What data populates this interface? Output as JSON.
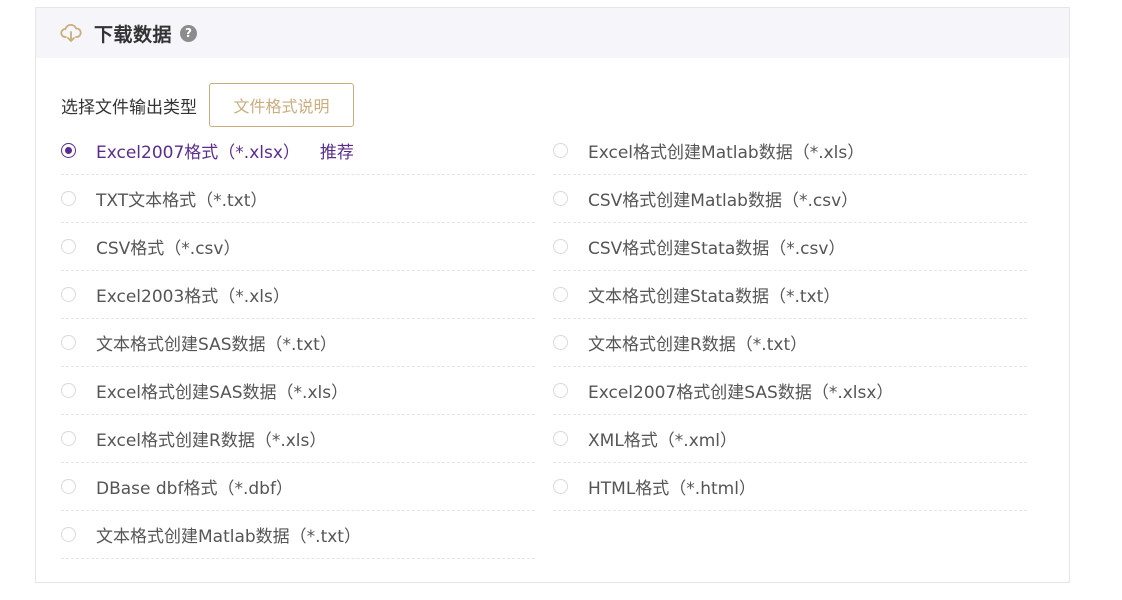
{
  "header": {
    "title": "下载数据",
    "help_icon_text": "?"
  },
  "file_type": {
    "label": "选择文件输出类型",
    "help_button": "文件格式说明"
  },
  "options": {
    "left": [
      {
        "label": "Excel2007格式（*.xlsx）",
        "selected": true,
        "badge": "推荐"
      },
      {
        "label": "TXT文本格式（*.txt）",
        "selected": false
      },
      {
        "label": "CSV格式（*.csv）",
        "selected": false
      },
      {
        "label": "Excel2003格式（*.xls）",
        "selected": false
      },
      {
        "label": "文本格式创建SAS数据（*.txt）",
        "selected": false
      },
      {
        "label": "Excel格式创建SAS数据（*.xls）",
        "selected": false
      },
      {
        "label": "Excel格式创建R数据（*.xls）",
        "selected": false
      },
      {
        "label": "DBase dbf格式（*.dbf）",
        "selected": false
      },
      {
        "label": "文本格式创建Matlab数据（*.txt）",
        "selected": false
      }
    ],
    "right": [
      {
        "label": "Excel格式创建Matlab数据（*.xls）",
        "selected": false
      },
      {
        "label": "CSV格式创建Matlab数据（*.csv）",
        "selected": false
      },
      {
        "label": "CSV格式创建Stata数据（*.csv）",
        "selected": false
      },
      {
        "label": "文本格式创建Stata数据（*.txt）",
        "selected": false
      },
      {
        "label": "文本格式创建R数据（*.txt）",
        "selected": false
      },
      {
        "label": "Excel2007格式创建SAS数据（*.xlsx）",
        "selected": false
      },
      {
        "label": "XML格式（*.xml）",
        "selected": false
      },
      {
        "label": "HTML格式（*.html）",
        "selected": false
      }
    ]
  },
  "colors": {
    "accent": "#5a2d8c",
    "button_border": "#c9ad7d",
    "header_bg": "#f6f6fa"
  },
  "icons": {
    "header": "cloud-download-icon",
    "help": "help-icon"
  }
}
